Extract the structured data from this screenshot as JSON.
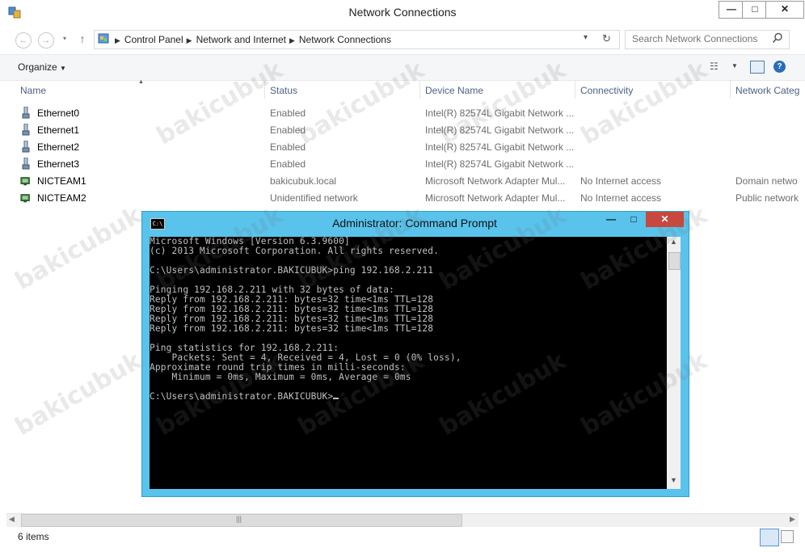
{
  "window": {
    "title": "Network Connections",
    "minimize_glyph": "—",
    "maximize_glyph": "□",
    "close_glyph": "✕"
  },
  "nav": {
    "back_icon": "back-arrow-icon",
    "forward_icon": "forward-arrow-icon",
    "up_icon": "up-arrow-icon",
    "breadcrumbs": [
      "Control Panel",
      "Network and Internet",
      "Network Connections"
    ],
    "search_placeholder": "Search Network Connections"
  },
  "toolbar": {
    "organize_label": "Organize"
  },
  "columns": [
    "Name",
    "Status",
    "Device Name",
    "Connectivity",
    "Network Categ"
  ],
  "rows": [
    {
      "name": "Ethernet0",
      "status": "Enabled",
      "device": "Intel(R) 82574L Gigabit Network ...",
      "connectivity": "",
      "category": "",
      "icon": "ethernet-adapter-icon"
    },
    {
      "name": "Ethernet1",
      "status": "Enabled",
      "device": "Intel(R) 82574L Gigabit Network ...",
      "connectivity": "",
      "category": "",
      "icon": "ethernet-adapter-icon"
    },
    {
      "name": "Ethernet2",
      "status": "Enabled",
      "device": "Intel(R) 82574L Gigabit Network ...",
      "connectivity": "",
      "category": "",
      "icon": "ethernet-adapter-icon"
    },
    {
      "name": "Ethernet3",
      "status": "Enabled",
      "device": "Intel(R) 82574L Gigabit Network ...",
      "connectivity": "",
      "category": "",
      "icon": "ethernet-adapter-icon"
    },
    {
      "name": "NICTEAM1",
      "status": "bakicubuk.local",
      "device": "Microsoft Network Adapter Mul...",
      "connectivity": "No Internet access",
      "category": "Domain netwo",
      "icon": "network-team-icon"
    },
    {
      "name": "NICTEAM2",
      "status": "Unidentified network",
      "device": "Microsoft Network Adapter Mul...",
      "connectivity": "No Internet access",
      "category": "Public network",
      "icon": "network-team-icon"
    }
  ],
  "cmd": {
    "title": "Administrator: Command Prompt",
    "icon_text": "C:\\",
    "lines": [
      "Microsoft Windows [Version 6.3.9600]",
      "(c) 2013 Microsoft Corporation. All rights reserved.",
      "",
      "C:\\Users\\administrator.BAKICUBUK>ping 192.168.2.211",
      "",
      "Pinging 192.168.2.211 with 32 bytes of data:",
      "Reply from 192.168.2.211: bytes=32 time<1ms TTL=128",
      "Reply from 192.168.2.211: bytes=32 time<1ms TTL=128",
      "Reply from 192.168.2.211: bytes=32 time<1ms TTL=128",
      "Reply from 192.168.2.211: bytes=32 time<1ms TTL=128",
      "",
      "Ping statistics for 192.168.2.211:",
      "    Packets: Sent = 4, Received = 4, Lost = 0 (0% loss),",
      "Approximate round trip times in milli-seconds:",
      "    Minimum = 0ms, Maximum = 0ms, Average = 0ms",
      "",
      "C:\\Users\\administrator.BAKICUBUK>"
    ]
  },
  "status": {
    "item_count": "6 items"
  },
  "watermark": "bakicubuk",
  "colors": {
    "cmd_frame": "#59c3ec",
    "close_red": "#c7483d",
    "header_text": "#4d6185"
  }
}
